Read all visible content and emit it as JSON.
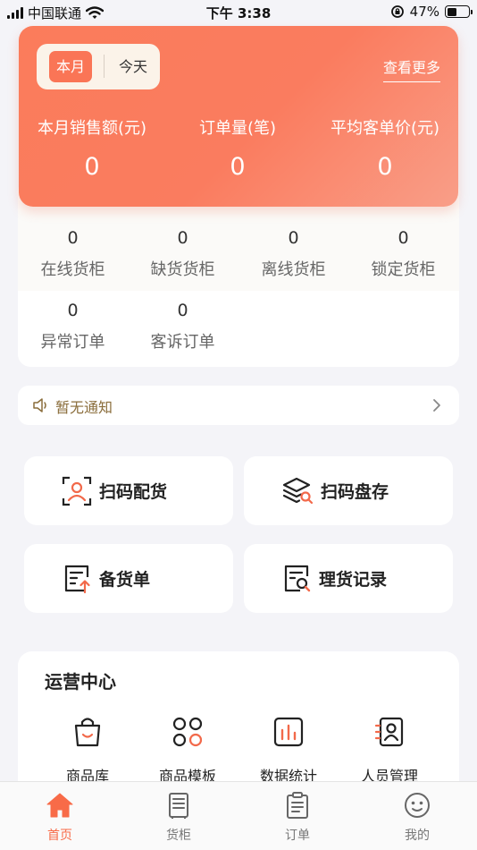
{
  "status_bar": {
    "carrier": "中国联通",
    "time": "下午 3:38",
    "battery": "47%",
    "battery_level": 0.47
  },
  "sales": {
    "period_tabs": [
      "本月",
      "今天"
    ],
    "see_more": "查看更多",
    "metrics": [
      {
        "label": "本月销售额(元)",
        "value": "0"
      },
      {
        "label": "订单量(笔)",
        "value": "0"
      },
      {
        "label": "平均客单价(元)",
        "value": "0"
      }
    ]
  },
  "cabinet_stats": [
    {
      "value": "0",
      "label": "在线货柜"
    },
    {
      "value": "0",
      "label": "缺货货柜"
    },
    {
      "value": "0",
      "label": "离线货柜"
    },
    {
      "value": "0",
      "label": "锁定货柜"
    },
    {
      "value": "0",
      "label": "异常订单"
    },
    {
      "value": "0",
      "label": "客诉订单"
    }
  ],
  "notice": {
    "text": "暂无通知"
  },
  "quick_actions": [
    {
      "label": "扫码配货",
      "icon": "scan-user-icon"
    },
    {
      "label": "扫码盘存",
      "icon": "layers-search-icon"
    },
    {
      "label": "备货单",
      "icon": "stock-list-icon"
    },
    {
      "label": "理货记录",
      "icon": "record-search-icon"
    }
  ],
  "ops_center": {
    "title": "运营中心",
    "items": [
      {
        "label": "商品库",
        "icon": "shopping-bag-icon"
      },
      {
        "label": "商品模板",
        "icon": "template-grid-icon"
      },
      {
        "label": "数据统计",
        "icon": "bar-chart-icon"
      },
      {
        "label": "人员管理",
        "icon": "person-card-icon"
      }
    ]
  },
  "tabbar": {
    "tabs": [
      {
        "label": "首页",
        "icon": "home-icon",
        "active": true
      },
      {
        "label": "货柜",
        "icon": "cabinet-icon",
        "active": false
      },
      {
        "label": "订单",
        "icon": "clipboard-icon",
        "active": false
      },
      {
        "label": "我的",
        "icon": "face-icon",
        "active": false
      }
    ]
  },
  "colors": {
    "accent": "#f86b48",
    "card_gradient_start": "#fb7c5b",
    "card_gradient_end": "#f99e88",
    "notice_text": "#8a6d3b"
  }
}
